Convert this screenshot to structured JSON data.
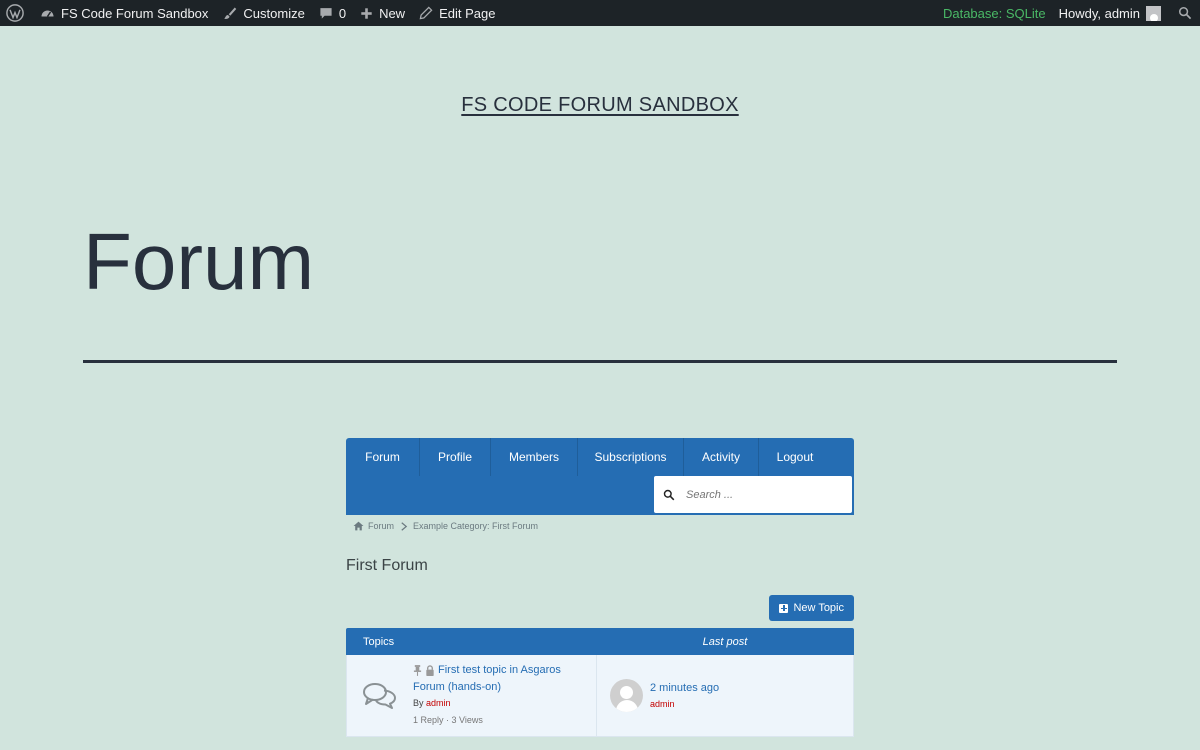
{
  "adminbar": {
    "site_name": "FS Code Forum Sandbox",
    "customize": "Customize",
    "comments_count": "0",
    "new": "New",
    "edit_page": "Edit Page",
    "database": "Database: SQLite",
    "howdy": "Howdy, admin"
  },
  "site": {
    "title": "FS CODE FORUM SANDBOX"
  },
  "page": {
    "title": "Forum"
  },
  "forum": {
    "nav": [
      {
        "label": "Forum"
      },
      {
        "label": "Profile"
      },
      {
        "label": "Members"
      },
      {
        "label": "Subscriptions"
      },
      {
        "label": "Activity"
      },
      {
        "label": "Logout"
      }
    ],
    "search_placeholder": "Search ...",
    "breadcrumb": {
      "home": "Forum",
      "current": "Example Category: First Forum"
    },
    "heading": "First Forum",
    "new_topic": "New Topic",
    "table": {
      "col_topics": "Topics",
      "col_last_post": "Last post"
    },
    "topics": [
      {
        "title": "First test topic in Asgaros Forum (hands-on)",
        "by_label": "By",
        "author": "admin",
        "stats": "1 Reply · 3 Views",
        "last_post_time": "2 minutes ago",
        "last_post_user": "admin"
      }
    ]
  },
  "colors": {
    "background": "#d1e4dd",
    "accent": "#256db3",
    "adminbar": "#1d2327",
    "db_text": "#4ab866",
    "author": "#c30000"
  }
}
